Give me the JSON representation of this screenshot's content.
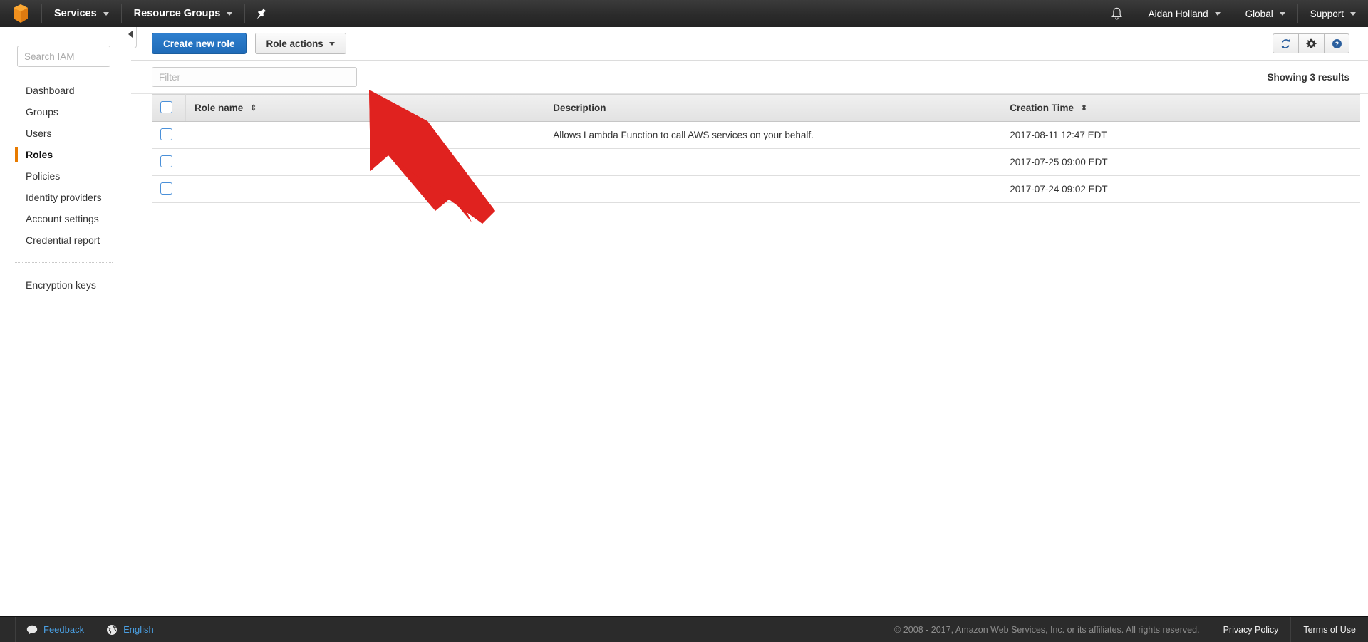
{
  "topnav": {
    "logo_icon": "aws-cube-logo",
    "services_label": "Services",
    "resource_groups_label": "Resource Groups",
    "pin_icon": "pin-icon",
    "bell_icon": "bell-notification-icon",
    "account_label": "Aidan Holland",
    "region_label": "Global",
    "support_label": "Support"
  },
  "sidebar": {
    "search_placeholder": "Search IAM",
    "search_value": "",
    "items": [
      {
        "label": "Dashboard",
        "active": false
      },
      {
        "label": "Groups",
        "active": false
      },
      {
        "label": "Users",
        "active": false
      },
      {
        "label": "Roles",
        "active": true
      },
      {
        "label": "Policies",
        "active": false
      },
      {
        "label": "Identity providers",
        "active": false
      },
      {
        "label": "Account settings",
        "active": false
      },
      {
        "label": "Credential report",
        "active": false
      }
    ],
    "secondary_items": [
      {
        "label": "Encryption keys"
      }
    ],
    "collapse_icon": "chevron-left-icon"
  },
  "toolbar": {
    "create_role_label": "Create new role",
    "role_actions_label": "Role actions",
    "refresh_icon": "refresh-icon",
    "settings_icon": "gear-icon",
    "help_icon": "help-question-icon"
  },
  "filterbar": {
    "filter_placeholder": "Filter",
    "filter_value": "",
    "results_text": "Showing 3 results"
  },
  "table": {
    "columns": [
      {
        "key": "check",
        "label": "",
        "sortable": false
      },
      {
        "key": "name",
        "label": "Role name",
        "sortable": true
      },
      {
        "key": "description",
        "label": "Description",
        "sortable": false
      },
      {
        "key": "creation_time",
        "label": "Creation Time",
        "sortable": true
      }
    ],
    "sort_glyph": "⇕",
    "rows": [
      {
        "checked": false,
        "name": "",
        "description": "Allows Lambda Function to call AWS services on your behalf.",
        "creation_time": "2017-08-11 12:47 EDT"
      },
      {
        "checked": false,
        "name": "",
        "description": "",
        "creation_time": "2017-07-25 09:00 EDT"
      },
      {
        "checked": false,
        "name": "",
        "description": "",
        "creation_time": "2017-07-24 09:02 EDT"
      }
    ]
  },
  "annotation": {
    "arrow_icon": "red-pointer-arrow",
    "color": "#E0221F"
  },
  "footer": {
    "feedback_label": "Feedback",
    "feedback_icon": "speech-bubble-icon",
    "language_label": "English",
    "language_icon": "globe-icon",
    "copyright": "© 2008 - 2017, Amazon Web Services, Inc. or its affiliates. All rights reserved.",
    "privacy_label": "Privacy Policy",
    "terms_label": "Terms of Use"
  },
  "colors": {
    "accent_orange": "#E87B00",
    "primary_blue": "#2E7FCE",
    "link_blue": "#4A9EE0",
    "nav_dark": "#2B2B2B",
    "arrow_red": "#E0221F"
  }
}
